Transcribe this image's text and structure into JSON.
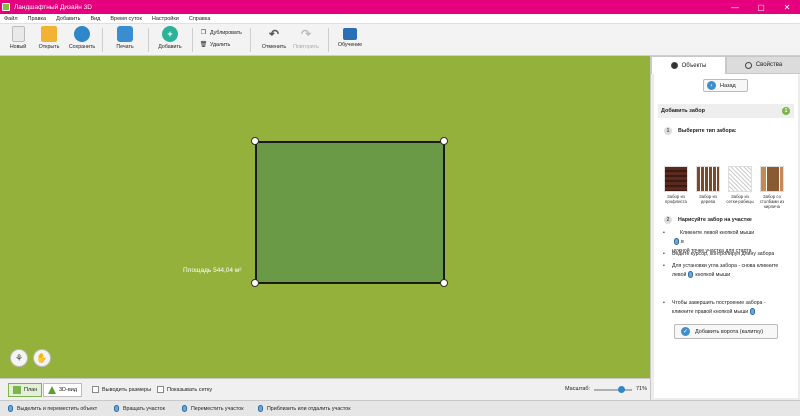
{
  "window": {
    "title": "Ландшафтный Дизайн 3D",
    "controls": [
      "—",
      "▢",
      "✕"
    ]
  },
  "menu": [
    "Файл",
    "Правка",
    "Добавить",
    "Вид",
    "Время суток",
    "Настройки",
    "Справка"
  ],
  "toolbar": {
    "new": "Новый",
    "open": "Открыть",
    "save": "Сохранить",
    "print": "Печать",
    "add": "Добавить",
    "duplicate": "Дублировать",
    "delete": "Удалить",
    "undo": "Отменить",
    "redo": "Повторить",
    "learn": "Обучение"
  },
  "canvas": {
    "area_label": "Площадь 544,04 м²",
    "colors": {
      "lawn": "#94b13c",
      "plot": "#6a9a45"
    }
  },
  "bottombar": {
    "plan": "План",
    "view3d": "3D-вид",
    "show_sizes": "Выводить размеры",
    "show_grid": "Показывать сетку",
    "zoom_label": "Масштаб:",
    "zoom_value": "71%",
    "zoom_fraction": 0.71
  },
  "statusbar": [
    "Выделить и переместить объект",
    "Вращать участок",
    "Переместить участок",
    "Приблизить или отдалить участок"
  ],
  "panel": {
    "tab_objects": "Объекты",
    "tab_properties": "Свойства",
    "back": "Назад",
    "section_title": "Добавить забор",
    "section_num": "1",
    "step1_num": "1",
    "step1": "Выберите тип забора:",
    "fences": [
      "Забор из профлиста",
      "Забор из дерева",
      "Забор из сетки-рабицы",
      "Забор со столбами из кирпича"
    ],
    "step2_num": "2",
    "step2": "Нарисуйте забор на участке",
    "bullets": {
      "b1a": "Кликните левой кнопкой мыши",
      "b1b": "в",
      "b1c": "нужной точке участка для старта",
      "b2": "Ведите курсор, контролируя длину забора",
      "b3a": "Для установки угла забора - снова кликните",
      "b3b": "левой",
      "b3c": "кнопкой мыши",
      "b4a": "Чтобы завершить построение забора -",
      "b4b": "кликните правой кнопкой мыши"
    },
    "add_gate": "Добавить ворота (калитку)"
  }
}
